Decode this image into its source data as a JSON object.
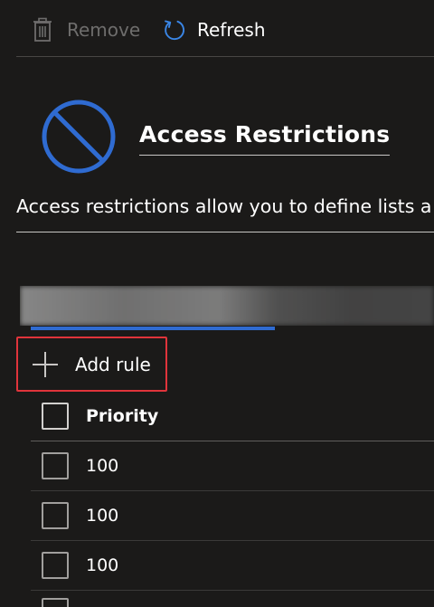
{
  "toolbar": {
    "remove_label": "Remove",
    "refresh_label": "Refresh",
    "remove_icon": "trash-icon",
    "refresh_icon": "refresh-icon"
  },
  "header": {
    "icon": "block-icon",
    "title": "Access Restrictions",
    "description": "Access restrictions allow you to define lists a"
  },
  "actions": {
    "add_rule_label": "Add rule",
    "add_icon": "plus-icon"
  },
  "table": {
    "columns": [
      "Priority"
    ],
    "rows": [
      {
        "priority": "100"
      },
      {
        "priority": "100"
      },
      {
        "priority": "100"
      }
    ]
  },
  "colors": {
    "background": "#1b1a19",
    "accent": "#2f6bd1",
    "highlight_border": "#e0343b",
    "disabled_text": "#6e6d6c"
  }
}
